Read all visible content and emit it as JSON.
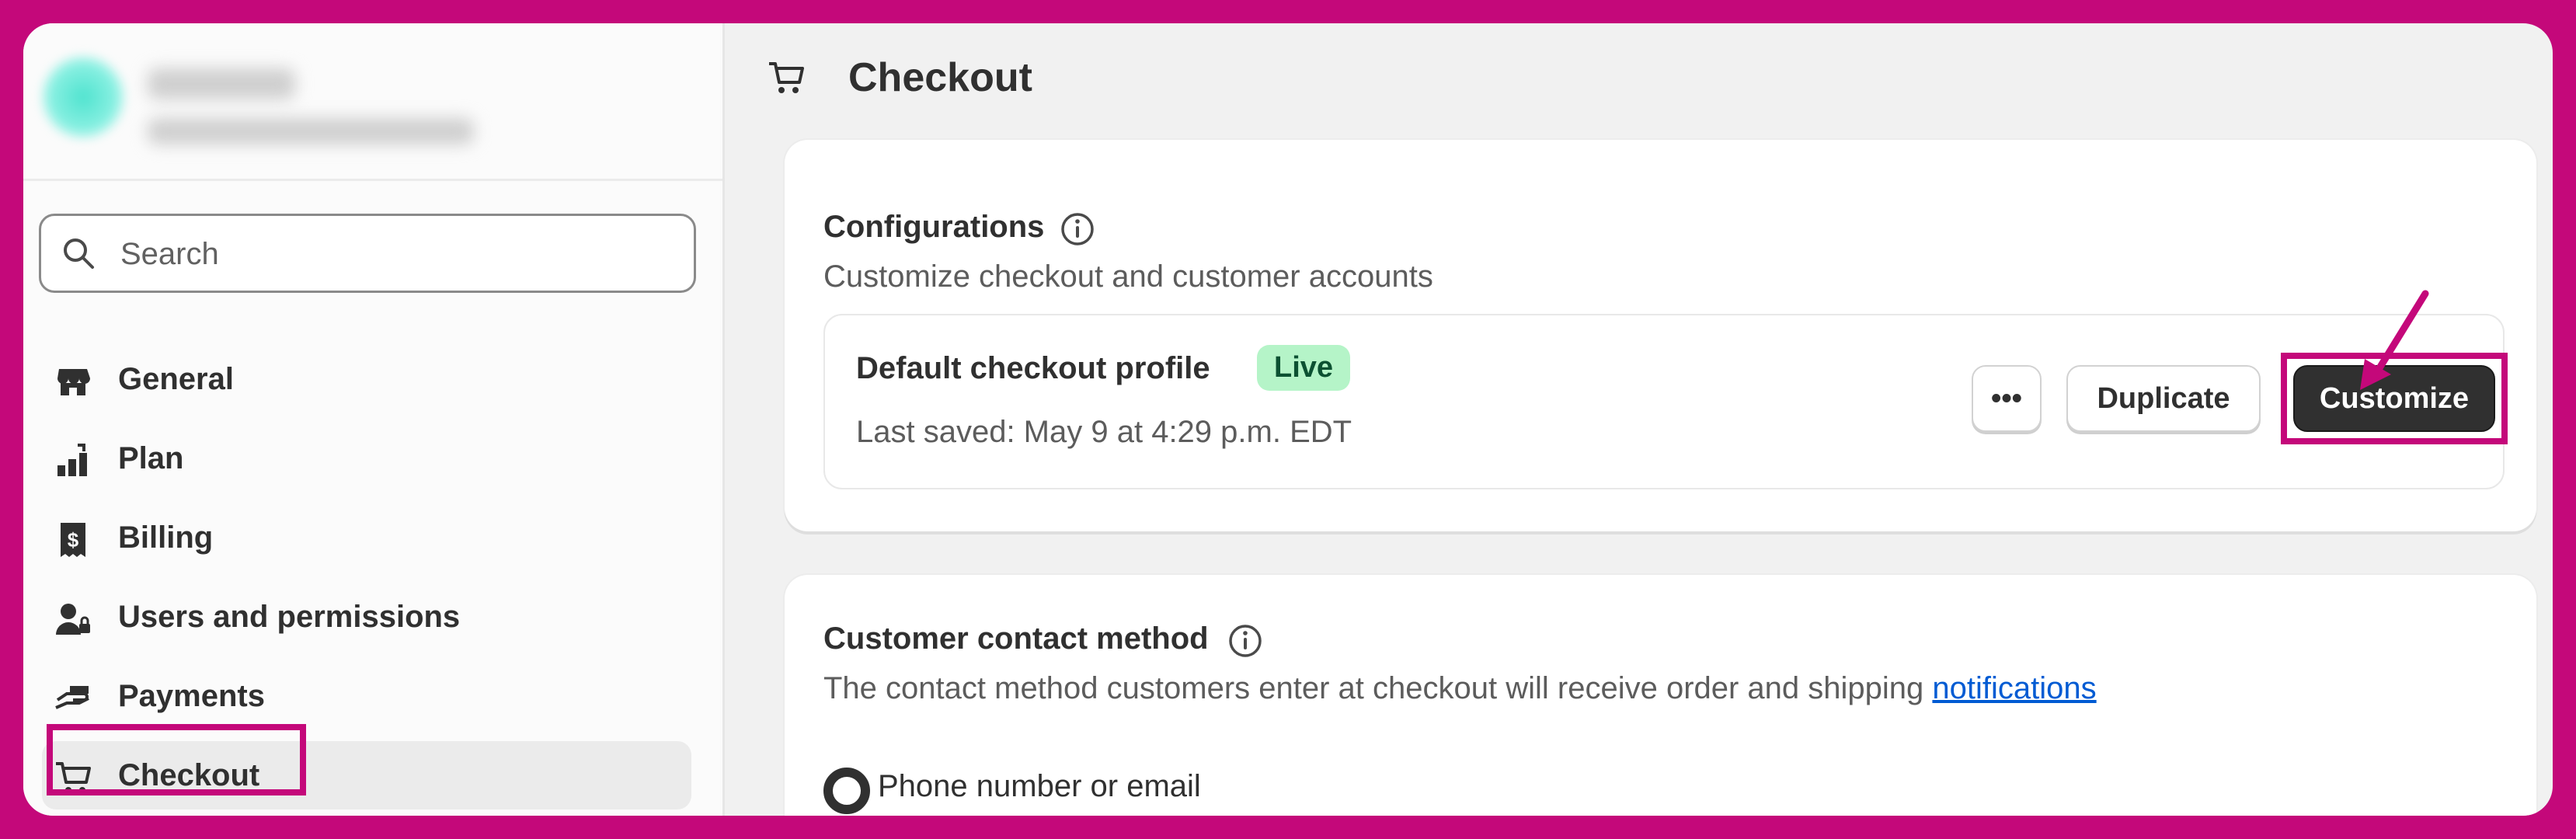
{
  "sidebar": {
    "search_placeholder": "Search",
    "items": [
      {
        "label": "General",
        "icon": "store-icon"
      },
      {
        "label": "Plan",
        "icon": "plan-icon"
      },
      {
        "label": "Billing",
        "icon": "billing-icon"
      },
      {
        "label": "Users and permissions",
        "icon": "users-icon"
      },
      {
        "label": "Payments",
        "icon": "payments-icon"
      },
      {
        "label": "Checkout",
        "icon": "cart-icon",
        "active": true
      }
    ]
  },
  "page": {
    "title": "Checkout",
    "title_icon": "cart-icon"
  },
  "configurations": {
    "title": "Configurations",
    "subtitle": "Customize checkout and customer accounts",
    "profile": {
      "name": "Default checkout profile",
      "badge": "Live",
      "last_saved": "Last saved: May 9 at 4:29 p.m. EDT",
      "more_label": "•••",
      "duplicate_label": "Duplicate",
      "customize_label": "Customize"
    }
  },
  "contact": {
    "title": "Customer contact method",
    "description": "The contact method customers enter at checkout will receive order and shipping",
    "link": "notifications",
    "option_label": "Phone number or email"
  },
  "colors": {
    "highlight": "#c4087a",
    "primary_button": "#303030",
    "live_badge": "#b5f4c8",
    "link": "#005bd3"
  }
}
